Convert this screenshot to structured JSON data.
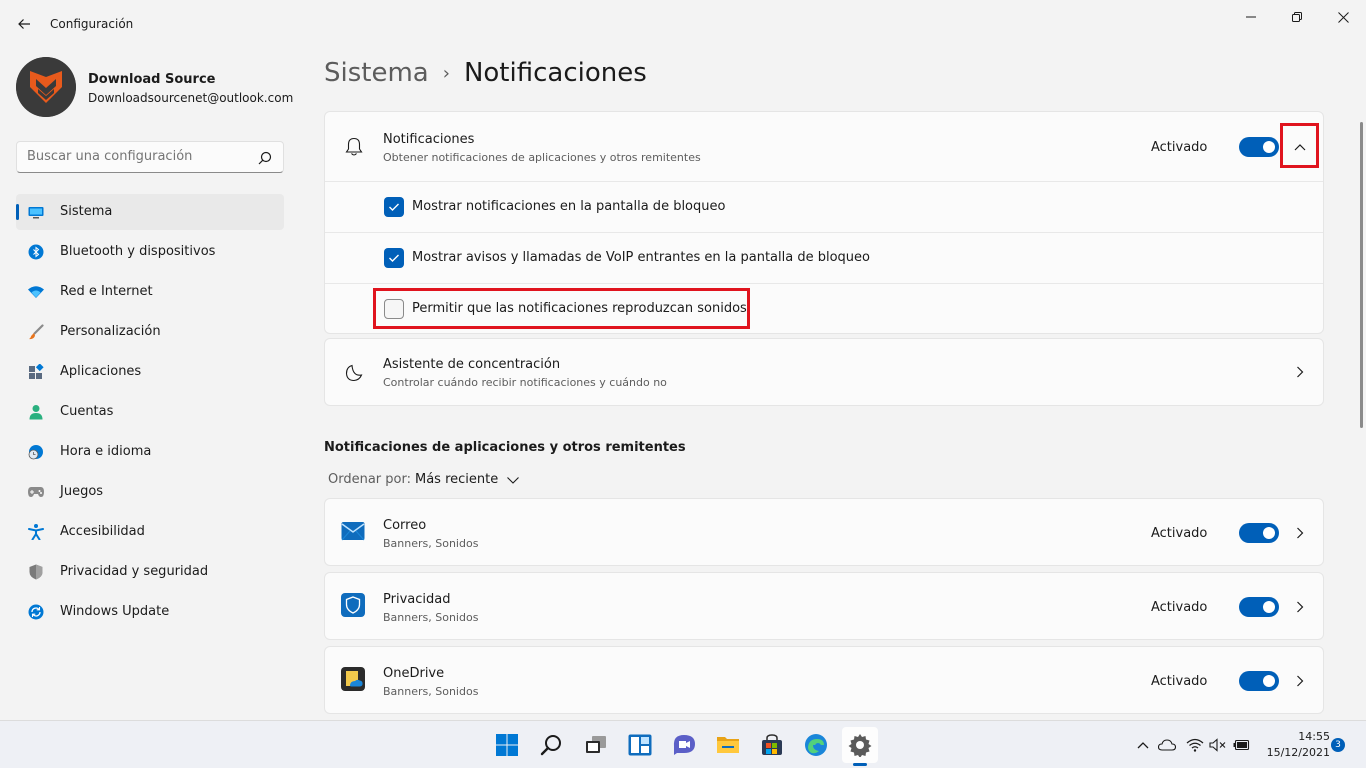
{
  "window": {
    "title": "Configuración"
  },
  "profile": {
    "name": "Download Source",
    "email": "Downloadsourcenet@outlook.com"
  },
  "search": {
    "placeholder": "Buscar una configuración"
  },
  "sidebar": {
    "items": [
      {
        "label": "Sistema",
        "icon": "monitor-icon",
        "active": true
      },
      {
        "label": "Bluetooth y dispositivos",
        "icon": "bluetooth-icon"
      },
      {
        "label": "Red e Internet",
        "icon": "wifi-icon"
      },
      {
        "label": "Personalización",
        "icon": "brush-icon"
      },
      {
        "label": "Aplicaciones",
        "icon": "apps-icon"
      },
      {
        "label": "Cuentas",
        "icon": "person-icon"
      },
      {
        "label": "Hora e idioma",
        "icon": "globe-clock-icon"
      },
      {
        "label": "Juegos",
        "icon": "gamepad-icon"
      },
      {
        "label": "Accesibilidad",
        "icon": "accessibility-icon"
      },
      {
        "label": "Privacidad y seguridad",
        "icon": "shield-icon"
      },
      {
        "label": "Windows Update",
        "icon": "update-icon"
      }
    ]
  },
  "breadcrumb": {
    "parent": "Sistema",
    "separator": "›",
    "current": "Notificaciones"
  },
  "notifications": {
    "title": "Notificaciones",
    "subtitle": "Obtener notificaciones de aplicaciones y otros remitentes",
    "state": "Activado",
    "toggle_on": true,
    "expanded": true,
    "options": [
      {
        "label": "Mostrar notificaciones en la pantalla de bloqueo",
        "checked": true
      },
      {
        "label": "Mostrar avisos y llamadas de VoIP entrantes en la pantalla de bloqueo",
        "checked": true
      },
      {
        "label": "Permitir que las notificaciones reproduzcan sonidos",
        "checked": false
      }
    ]
  },
  "focus_assist": {
    "title": "Asistente de concentración",
    "subtitle": "Controlar cuándo recibir notificaciones y cuándo no"
  },
  "apps_section": {
    "title": "Notificaciones de aplicaciones y otros remitentes",
    "sort_label": "Ordenar por:",
    "sort_value": "Más reciente",
    "apps": [
      {
        "name": "Correo",
        "detail": "Banners, Sonidos",
        "state": "Activado",
        "icon": "mail-icon",
        "toggle_on": true
      },
      {
        "name": "Privacidad",
        "detail": "Banners, Sonidos",
        "state": "Activado",
        "icon": "shield-app-icon",
        "toggle_on": true
      },
      {
        "name": "OneDrive",
        "detail": "Banners, Sonidos",
        "state": "Activado",
        "icon": "onedrive-icon",
        "toggle_on": true
      }
    ]
  },
  "taskbar": {
    "time": "14:55",
    "date": "15/12/2021",
    "notification_count": "3"
  },
  "colors": {
    "accent": "#005fb8",
    "highlight": "#e0141e",
    "background": "#f3f3f3"
  }
}
